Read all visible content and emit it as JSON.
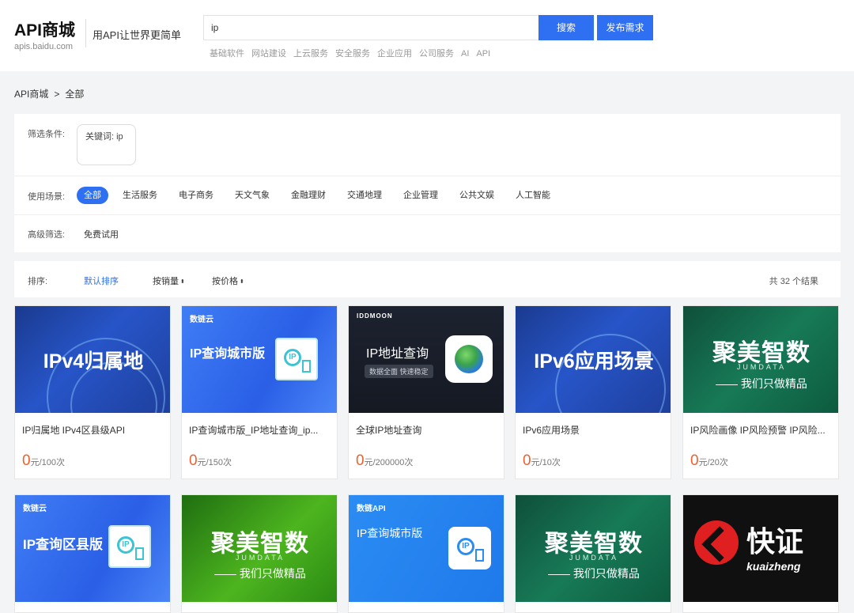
{
  "header": {
    "logo_title": "API商城",
    "logo_sub": "apis.baidu.com",
    "slogan": "用API让世界更简单",
    "search_value": "ip",
    "search_button": "搜索",
    "publish_button": "发布需求",
    "hotwords": [
      "基础软件",
      "网站建设",
      "上云服务",
      "安全服务",
      "企业应用",
      "公司服务",
      "AI",
      "API"
    ]
  },
  "breadcrumb": {
    "root": "API商城",
    "sep": ">",
    "current": "全部"
  },
  "filter": {
    "condition_label": "筛选条件:",
    "keyword_chip": "关键词: ip",
    "scene_label": "使用场景:",
    "scenes": [
      "全部",
      "生活服务",
      "电子商务",
      "天文气象",
      "金融理财",
      "交通地理",
      "企业管理",
      "公共文娱",
      "人工智能"
    ],
    "advanced_label": "高级筛选:",
    "advanced_item": "免费试用"
  },
  "sort": {
    "label": "排序:",
    "default": "默认排序",
    "by_sales": "按销量",
    "by_price": "按价格",
    "caret": "⬍",
    "result_count": "共 32 个结果"
  },
  "cards": [
    {
      "title": "IP归属地 IPv4区县级API",
      "price": "0",
      "unit": "元/100次",
      "banner": "IPv4归属地"
    },
    {
      "title": "IP查询城市版_IP地址查询_ip...",
      "price": "0",
      "unit": "元/150次",
      "brand": "数链云",
      "banner": "IP查询城市版",
      "icon_text": "IP"
    },
    {
      "title": "全球IP地址查询",
      "price": "0",
      "unit": "元/200000次",
      "brand": "IDDMOON",
      "banner": "IP地址查询",
      "pill": "数据全面 快速稳定"
    },
    {
      "title": "IPv6应用场景",
      "price": "0",
      "unit": "元/10次",
      "banner": "IPv6应用场景"
    },
    {
      "title": "IP风险画像 IP风险预警 IP风险...",
      "price": "0",
      "unit": "元/20次",
      "banner": "聚美智数",
      "sub": "JUMDATA",
      "line": "—— 我们只做精品"
    }
  ],
  "cards_row2": [
    {
      "brand": "数链云",
      "banner": "IP查询区县版",
      "icon_text": "IP"
    },
    {
      "banner": "聚美智数",
      "sub": "JUMDATA",
      "line": "—— 我们只做精品"
    },
    {
      "brand": "数链API",
      "banner": "IP查询城市版",
      "icon_text": "IP"
    },
    {
      "banner": "聚美智数",
      "sub": "JUMDATA",
      "line": "—— 我们只做精品"
    },
    {
      "banner": "快证",
      "sub": "kuaizheng"
    }
  ]
}
